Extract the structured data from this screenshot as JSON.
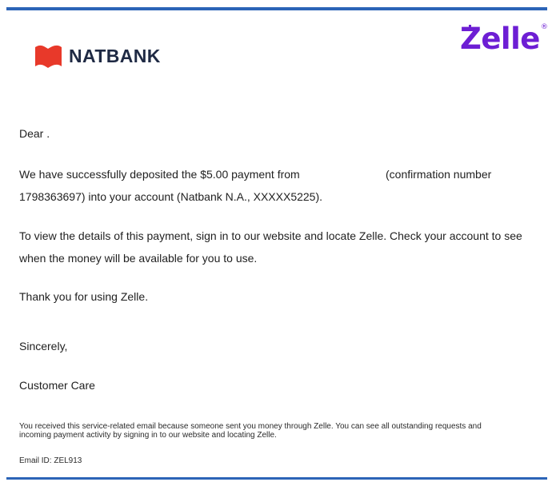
{
  "header": {
    "natbank_name": "NATBANK",
    "zelle_name": "Zelle",
    "zelle_reg": "®"
  },
  "letter": {
    "greeting": "Dear .",
    "p1_line1": "We have successfully deposited the $5.00 payment from",
    "p1_conf": "(confirmation number",
    "p1_line2": "1798363697) into your account (Natbank N.A., XXXXX5225).",
    "p2_line1": "To view the details of this payment, sign in to our website and locate Zelle. Check your account to see",
    "p2_line2": "when the money will be available for you to use.",
    "thanks": "Thank you for using Zelle.",
    "closing": "Sincerely,",
    "signature": "Customer Care"
  },
  "footer": {
    "notice_line1": "You received this service-related email because someone sent you money through Zelle. You can see all outstanding requests and",
    "notice_line2": "incoming payment activity by signing in to our website and locating Zelle.",
    "email_id": "Email ID: ZEL913"
  },
  "colors": {
    "accent_bar": "#2c64b7",
    "natbank_red": "#e8392a",
    "natbank_text": "#1f2a44",
    "zelle_purple": "#6d1ed4"
  }
}
